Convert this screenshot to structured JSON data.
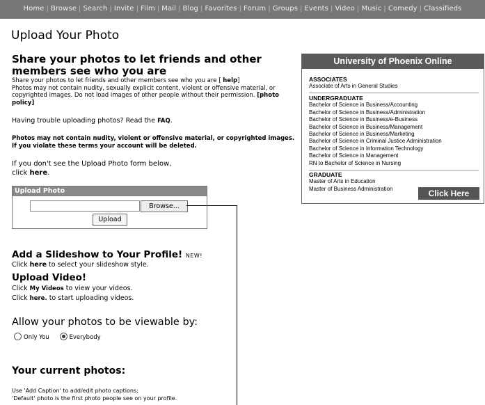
{
  "nav": {
    "items": [
      "Home",
      "Browse",
      "Search",
      "Invite",
      "Film",
      "Mail",
      "Blog",
      "Favorites",
      "Forum",
      "Groups",
      "Events",
      "Video",
      "Music",
      "Comedy",
      "Classifieds"
    ]
  },
  "page": {
    "title": "Upload Your Photo"
  },
  "share": {
    "heading": "Share your photos to let friends and other members see who you are",
    "line1_pre": "Share your photos to let friends and other members see who you are [ ",
    "help_link": "help",
    "line1_post": "]",
    "line2": "Photos may not contain nudity, sexually explicit content, violent or offensive material, or copyrighted images. Do not load images of other people without their permission. ",
    "policy_link": "[photo policy]"
  },
  "trouble": {
    "pre": "Having trouble uploading photos? Read the ",
    "faq_link": "FAQ",
    "post": "."
  },
  "warning": "Photos may not contain nudity, violent or offensive material, or copyrighted images. If you violate these terms your account will be deleted.",
  "ifnot": {
    "pre": "If you don't see the Upload Photo form below, click ",
    "here_link": "here",
    "post": "."
  },
  "upload": {
    "title": "Upload Photo",
    "file_value": "",
    "browse_label": "Browse...",
    "upload_label": "Upload"
  },
  "slideshow": {
    "heading": "Add a Slideshow to Your Profile!",
    "new_badge": "NEW!",
    "pre": "Click ",
    "here_link": "here",
    "post": " to select your slideshow style."
  },
  "video": {
    "heading": "Upload Video!",
    "l1_pre": "Click ",
    "my_videos_link": "My Videos",
    "l1_post": " to view your videos.",
    "l2_pre": "Click ",
    "here_link": "here.",
    "l2_post": " to start uploading videos."
  },
  "allow": {
    "heading": "Allow your photos to be viewable by:",
    "option1": "Only You",
    "option2": "Everybody",
    "selected": "Everybody"
  },
  "current": {
    "heading": "Your current photos:",
    "line1": "Use 'Add Caption' to add/edit photo captions;",
    "line2": "'Default' photo is the first photo people see on your profile."
  },
  "ad": {
    "title": "University of Phoenix Online",
    "associates": {
      "heading": "ASSOCIATES",
      "items": [
        "Associate of Arts in General Studies"
      ]
    },
    "undergraduate": {
      "heading": "UNDERGRADUATE",
      "items": [
        "Bachelor of Science in Business/Accounting",
        "Bachelor of Science in Business/Administration",
        "Bachelor of Science in Business/e-Business",
        "Bachelor of Science in Business/Management",
        "Bachelor of Science in Business/Marketing",
        "Bachelor of Science in Criminal Justice Administration",
        "Bachelor of Science in Information Technology",
        "Bachelor of Science in Management",
        "RN to Bachelor of Science in Nursing"
      ]
    },
    "graduate": {
      "heading": "GRADUATE",
      "items": [
        "Master of Arts in Education",
        "Master of Business Administration"
      ]
    },
    "button": "Click Here"
  },
  "colors": {
    "nav_bg": "#777777",
    "panel_header": "#888888",
    "ad_header": "#5a5a5a"
  }
}
